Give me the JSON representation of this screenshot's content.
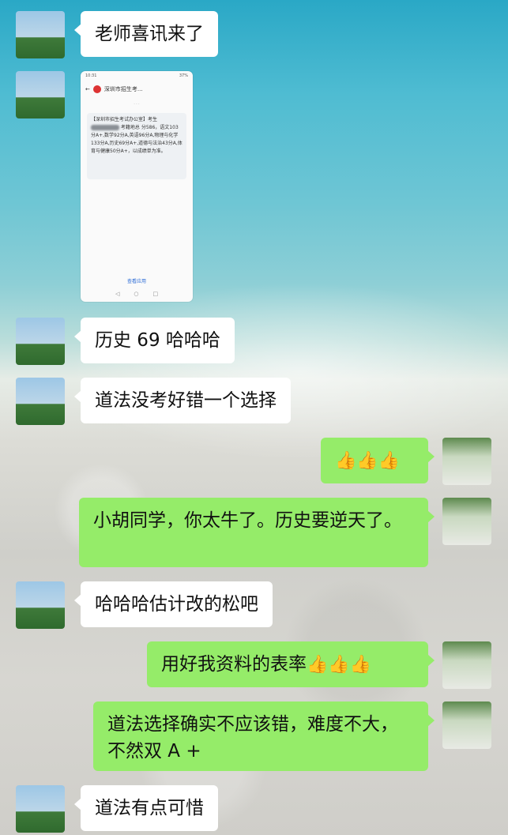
{
  "messages": [
    {
      "side": "left",
      "text": "老师喜讯来了"
    },
    {
      "side": "left",
      "type": "image"
    },
    {
      "side": "left",
      "text": "历史 69 哈哈哈"
    },
    {
      "side": "left",
      "text": "道法没考好错一个选择"
    },
    {
      "side": "right",
      "text": "👍👍👍"
    },
    {
      "side": "right",
      "text": "小胡同学，你太牛了。历史要逆天了。"
    },
    {
      "side": "left",
      "text": "哈哈哈估计改的松吧"
    },
    {
      "side": "right",
      "text": "用好我资料的表率",
      "emoji": "👍👍👍"
    },
    {
      "side": "right",
      "text": "道法选择确实不应该错，难度不大，不然双 A +"
    },
    {
      "side": "left",
      "text": "道法有点可惜"
    }
  ],
  "sms": {
    "status_time": "10:31",
    "status_right": "37%",
    "sender": "深圳市招生考...",
    "back_icon": "back-arrow-icon",
    "body_prefix": "【深圳市招生考试办公室】考生",
    "body_mid": "考籍地总",
    "body_rest": "分586，语文103分A+,数学92分A,英语96分A,物理与化学133分A,历史69分A+,道德与法治43分A,体育与健康50分A+，以成绩单为准。",
    "bottom_link": "查看应用"
  }
}
